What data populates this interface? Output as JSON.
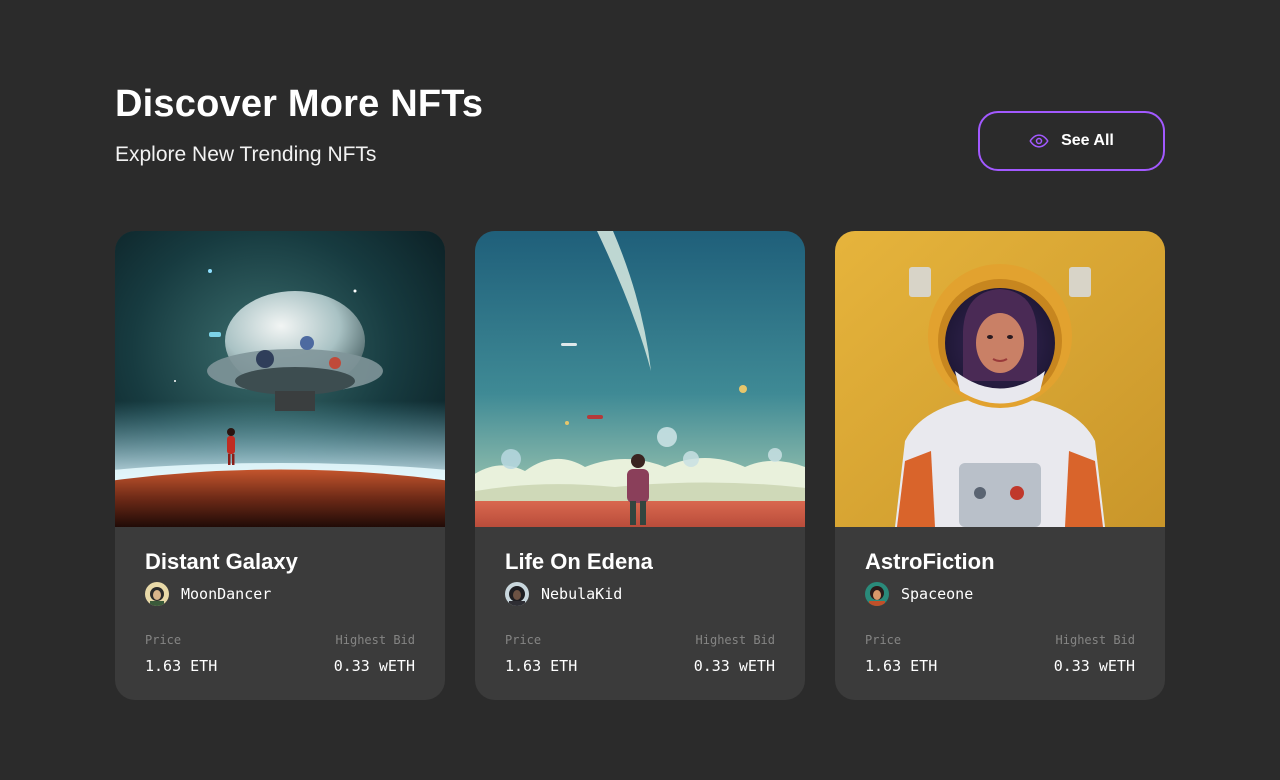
{
  "header": {
    "title": "Discover More NFTs",
    "subtitle": "Explore New Trending NFTs"
  },
  "see_all": {
    "label": "See All",
    "icon": "eye-icon",
    "border_color": "#a259ff"
  },
  "cards": [
    {
      "title": "Distant Galaxy",
      "artist": "MoonDancer",
      "price_label": "Price",
      "price": "1.63 ETH",
      "bid_label": "Highest Bid",
      "bid": "0.33 wETH"
    },
    {
      "title": "Life On Edena",
      "artist": "NebulaKid",
      "price_label": "Price",
      "price": "1.63 ETH",
      "bid_label": "Highest Bid",
      "bid": "0.33 wETH"
    },
    {
      "title": "AstroFiction",
      "artist": "Spaceone",
      "price_label": "Price",
      "price": "1.63 ETH",
      "bid_label": "Highest Bid",
      "bid": "0.33 wETH"
    }
  ],
  "colors": {
    "background": "#2b2b2b",
    "card": "#3b3b3b",
    "accent": "#a259ff",
    "muted_text": "#858584"
  }
}
